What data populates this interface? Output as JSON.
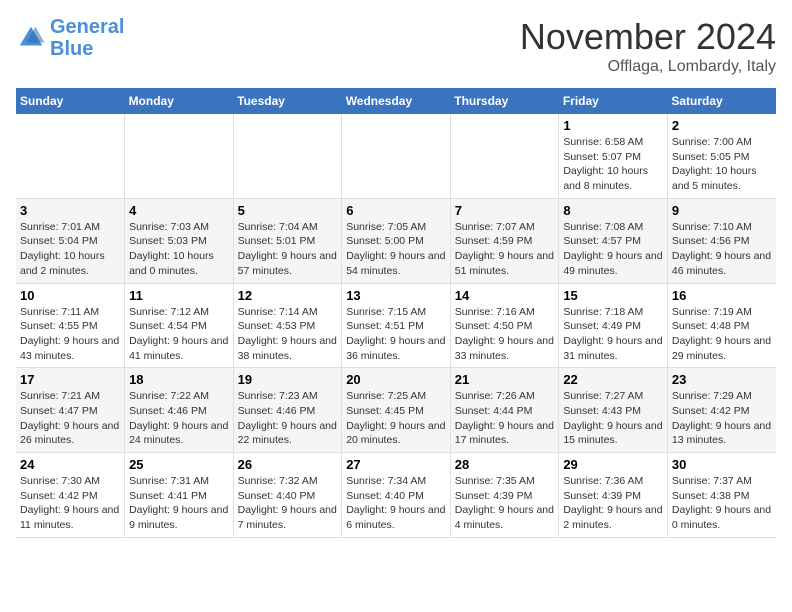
{
  "header": {
    "logo_general": "General",
    "logo_blue": "Blue",
    "month_title": "November 2024",
    "location": "Offlaga, Lombardy, Italy"
  },
  "weekdays": [
    "Sunday",
    "Monday",
    "Tuesday",
    "Wednesday",
    "Thursday",
    "Friday",
    "Saturday"
  ],
  "weeks": [
    [
      {
        "day": "",
        "sunrise": "",
        "sunset": "",
        "daylight": ""
      },
      {
        "day": "",
        "sunrise": "",
        "sunset": "",
        "daylight": ""
      },
      {
        "day": "",
        "sunrise": "",
        "sunset": "",
        "daylight": ""
      },
      {
        "day": "",
        "sunrise": "",
        "sunset": "",
        "daylight": ""
      },
      {
        "day": "",
        "sunrise": "",
        "sunset": "",
        "daylight": ""
      },
      {
        "day": "1",
        "sunrise": "Sunrise: 6:58 AM",
        "sunset": "Sunset: 5:07 PM",
        "daylight": "Daylight: 10 hours and 8 minutes."
      },
      {
        "day": "2",
        "sunrise": "Sunrise: 7:00 AM",
        "sunset": "Sunset: 5:05 PM",
        "daylight": "Daylight: 10 hours and 5 minutes."
      }
    ],
    [
      {
        "day": "3",
        "sunrise": "Sunrise: 7:01 AM",
        "sunset": "Sunset: 5:04 PM",
        "daylight": "Daylight: 10 hours and 2 minutes."
      },
      {
        "day": "4",
        "sunrise": "Sunrise: 7:03 AM",
        "sunset": "Sunset: 5:03 PM",
        "daylight": "Daylight: 10 hours and 0 minutes."
      },
      {
        "day": "5",
        "sunrise": "Sunrise: 7:04 AM",
        "sunset": "Sunset: 5:01 PM",
        "daylight": "Daylight: 9 hours and 57 minutes."
      },
      {
        "day": "6",
        "sunrise": "Sunrise: 7:05 AM",
        "sunset": "Sunset: 5:00 PM",
        "daylight": "Daylight: 9 hours and 54 minutes."
      },
      {
        "day": "7",
        "sunrise": "Sunrise: 7:07 AM",
        "sunset": "Sunset: 4:59 PM",
        "daylight": "Daylight: 9 hours and 51 minutes."
      },
      {
        "day": "8",
        "sunrise": "Sunrise: 7:08 AM",
        "sunset": "Sunset: 4:57 PM",
        "daylight": "Daylight: 9 hours and 49 minutes."
      },
      {
        "day": "9",
        "sunrise": "Sunrise: 7:10 AM",
        "sunset": "Sunset: 4:56 PM",
        "daylight": "Daylight: 9 hours and 46 minutes."
      }
    ],
    [
      {
        "day": "10",
        "sunrise": "Sunrise: 7:11 AM",
        "sunset": "Sunset: 4:55 PM",
        "daylight": "Daylight: 9 hours and 43 minutes."
      },
      {
        "day": "11",
        "sunrise": "Sunrise: 7:12 AM",
        "sunset": "Sunset: 4:54 PM",
        "daylight": "Daylight: 9 hours and 41 minutes."
      },
      {
        "day": "12",
        "sunrise": "Sunrise: 7:14 AM",
        "sunset": "Sunset: 4:53 PM",
        "daylight": "Daylight: 9 hours and 38 minutes."
      },
      {
        "day": "13",
        "sunrise": "Sunrise: 7:15 AM",
        "sunset": "Sunset: 4:51 PM",
        "daylight": "Daylight: 9 hours and 36 minutes."
      },
      {
        "day": "14",
        "sunrise": "Sunrise: 7:16 AM",
        "sunset": "Sunset: 4:50 PM",
        "daylight": "Daylight: 9 hours and 33 minutes."
      },
      {
        "day": "15",
        "sunrise": "Sunrise: 7:18 AM",
        "sunset": "Sunset: 4:49 PM",
        "daylight": "Daylight: 9 hours and 31 minutes."
      },
      {
        "day": "16",
        "sunrise": "Sunrise: 7:19 AM",
        "sunset": "Sunset: 4:48 PM",
        "daylight": "Daylight: 9 hours and 29 minutes."
      }
    ],
    [
      {
        "day": "17",
        "sunrise": "Sunrise: 7:21 AM",
        "sunset": "Sunset: 4:47 PM",
        "daylight": "Daylight: 9 hours and 26 minutes."
      },
      {
        "day": "18",
        "sunrise": "Sunrise: 7:22 AM",
        "sunset": "Sunset: 4:46 PM",
        "daylight": "Daylight: 9 hours and 24 minutes."
      },
      {
        "day": "19",
        "sunrise": "Sunrise: 7:23 AM",
        "sunset": "Sunset: 4:46 PM",
        "daylight": "Daylight: 9 hours and 22 minutes."
      },
      {
        "day": "20",
        "sunrise": "Sunrise: 7:25 AM",
        "sunset": "Sunset: 4:45 PM",
        "daylight": "Daylight: 9 hours and 20 minutes."
      },
      {
        "day": "21",
        "sunrise": "Sunrise: 7:26 AM",
        "sunset": "Sunset: 4:44 PM",
        "daylight": "Daylight: 9 hours and 17 minutes."
      },
      {
        "day": "22",
        "sunrise": "Sunrise: 7:27 AM",
        "sunset": "Sunset: 4:43 PM",
        "daylight": "Daylight: 9 hours and 15 minutes."
      },
      {
        "day": "23",
        "sunrise": "Sunrise: 7:29 AM",
        "sunset": "Sunset: 4:42 PM",
        "daylight": "Daylight: 9 hours and 13 minutes."
      }
    ],
    [
      {
        "day": "24",
        "sunrise": "Sunrise: 7:30 AM",
        "sunset": "Sunset: 4:42 PM",
        "daylight": "Daylight: 9 hours and 11 minutes."
      },
      {
        "day": "25",
        "sunrise": "Sunrise: 7:31 AM",
        "sunset": "Sunset: 4:41 PM",
        "daylight": "Daylight: 9 hours and 9 minutes."
      },
      {
        "day": "26",
        "sunrise": "Sunrise: 7:32 AM",
        "sunset": "Sunset: 4:40 PM",
        "daylight": "Daylight: 9 hours and 7 minutes."
      },
      {
        "day": "27",
        "sunrise": "Sunrise: 7:34 AM",
        "sunset": "Sunset: 4:40 PM",
        "daylight": "Daylight: 9 hours and 6 minutes."
      },
      {
        "day": "28",
        "sunrise": "Sunrise: 7:35 AM",
        "sunset": "Sunset: 4:39 PM",
        "daylight": "Daylight: 9 hours and 4 minutes."
      },
      {
        "day": "29",
        "sunrise": "Sunrise: 7:36 AM",
        "sunset": "Sunset: 4:39 PM",
        "daylight": "Daylight: 9 hours and 2 minutes."
      },
      {
        "day": "30",
        "sunrise": "Sunrise: 7:37 AM",
        "sunset": "Sunset: 4:38 PM",
        "daylight": "Daylight: 9 hours and 0 minutes."
      }
    ]
  ]
}
